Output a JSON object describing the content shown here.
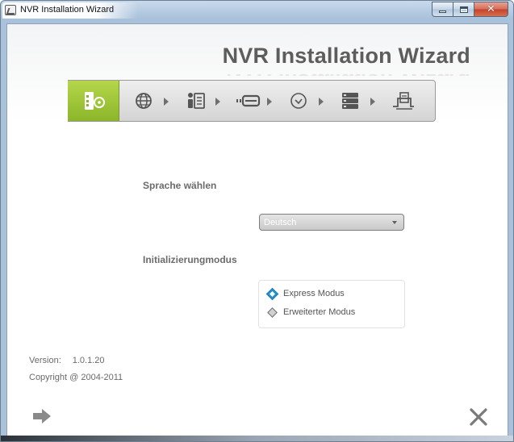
{
  "window": {
    "title": "NVR Installation Wizard",
    "controls": {
      "minimize": "minimize",
      "maximize": "maximize",
      "close": "close"
    }
  },
  "header": {
    "brand_title": "NVR Installation Wizard"
  },
  "steps": [
    {
      "icon": "computer-cd-icon",
      "state": "active"
    },
    {
      "icon": "globe-icon",
      "state": "pending"
    },
    {
      "icon": "user-document-icon",
      "state": "pending"
    },
    {
      "icon": "hard-drive-icon",
      "state": "pending"
    },
    {
      "icon": "clock-icon",
      "state": "pending"
    },
    {
      "icon": "server-stack-icon",
      "state": "pending"
    },
    {
      "icon": "install-finish-icon",
      "state": "pending"
    }
  ],
  "language": {
    "label": "Sprache wählen",
    "selected": "Deutsch"
  },
  "init_mode": {
    "label": "Initializierungmodus",
    "options": [
      {
        "label": "Express Modus",
        "selected": true
      },
      {
        "label": "Erweiterter Modus",
        "selected": false
      }
    ]
  },
  "footer": {
    "version_label": "Version:",
    "version_value": "1.0.1.20",
    "copyright": "Copyright @ 2004-2011"
  },
  "colors": {
    "accent_green": "#9cc43a",
    "radio_blue": "#1a8fd0",
    "text_gray": "#6b6b6b"
  }
}
